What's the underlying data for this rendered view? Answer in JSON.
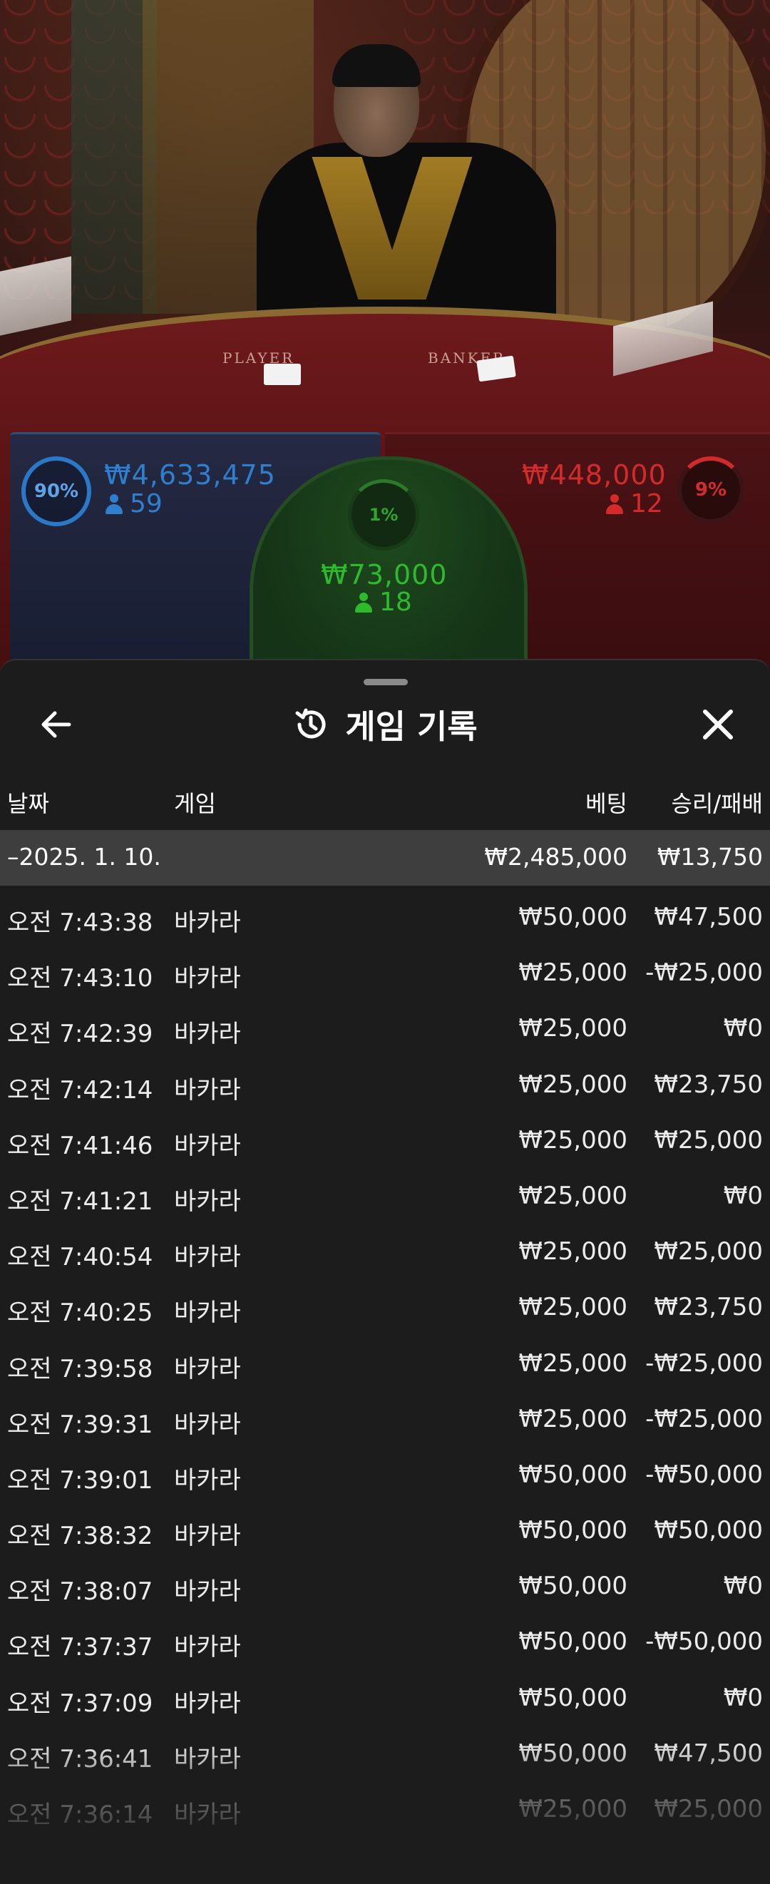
{
  "video": {
    "table_labels": [
      "PLAYER",
      "BANKER"
    ]
  },
  "bets": {
    "player": {
      "percent": "90%",
      "amount": "₩4,633,475",
      "players": "59",
      "color": "#2e7fd0"
    },
    "tie": {
      "percent": "1%",
      "amount": "₩73,000",
      "players": "18",
      "color": "#2dbb2d"
    },
    "banker": {
      "percent": "9%",
      "amount": "₩448,000",
      "players": "12",
      "color": "#d42a2a"
    }
  },
  "history": {
    "title": "게임 기록",
    "back_icon": "arrow-left-icon",
    "history_icon": "history-icon",
    "close_icon": "close-icon",
    "columns": {
      "date": "날짜",
      "game": "게임",
      "bet": "베팅",
      "result": "승리/패배"
    },
    "date_group": {
      "date": "–2025. 1. 10.",
      "bet_total": "₩2,485,000",
      "result_total": "₩13,750"
    },
    "rows": [
      {
        "time": "오전 7:43:38",
        "game": "바카라",
        "bet": "₩50,000",
        "result": "₩47,500"
      },
      {
        "time": "오전 7:43:10",
        "game": "바카라",
        "bet": "₩25,000",
        "result": "-₩25,000"
      },
      {
        "time": "오전 7:42:39",
        "game": "바카라",
        "bet": "₩25,000",
        "result": "₩0"
      },
      {
        "time": "오전 7:42:14",
        "game": "바카라",
        "bet": "₩25,000",
        "result": "₩23,750"
      },
      {
        "time": "오전 7:41:46",
        "game": "바카라",
        "bet": "₩25,000",
        "result": "₩25,000"
      },
      {
        "time": "오전 7:41:21",
        "game": "바카라",
        "bet": "₩25,000",
        "result": "₩0"
      },
      {
        "time": "오전 7:40:54",
        "game": "바카라",
        "bet": "₩25,000",
        "result": "₩25,000"
      },
      {
        "time": "오전 7:40:25",
        "game": "바카라",
        "bet": "₩25,000",
        "result": "₩23,750"
      },
      {
        "time": "오전 7:39:58",
        "game": "바카라",
        "bet": "₩25,000",
        "result": "-₩25,000"
      },
      {
        "time": "오전 7:39:31",
        "game": "바카라",
        "bet": "₩25,000",
        "result": "-₩25,000"
      },
      {
        "time": "오전 7:39:01",
        "game": "바카라",
        "bet": "₩50,000",
        "result": "-₩50,000"
      },
      {
        "time": "오전 7:38:32",
        "game": "바카라",
        "bet": "₩50,000",
        "result": "₩50,000"
      },
      {
        "time": "오전 7:38:07",
        "game": "바카라",
        "bet": "₩50,000",
        "result": "₩0"
      },
      {
        "time": "오전 7:37:37",
        "game": "바카라",
        "bet": "₩50,000",
        "result": "-₩50,000"
      },
      {
        "time": "오전 7:37:09",
        "game": "바카라",
        "bet": "₩50,000",
        "result": "₩0"
      },
      {
        "time": "오전 7:36:41",
        "game": "바카라",
        "bet": "₩50,000",
        "result": "₩47,500"
      },
      {
        "time": "오전 7:36:14",
        "game": "바카라",
        "bet": "₩25,000",
        "result": "₩25,000"
      }
    ]
  }
}
